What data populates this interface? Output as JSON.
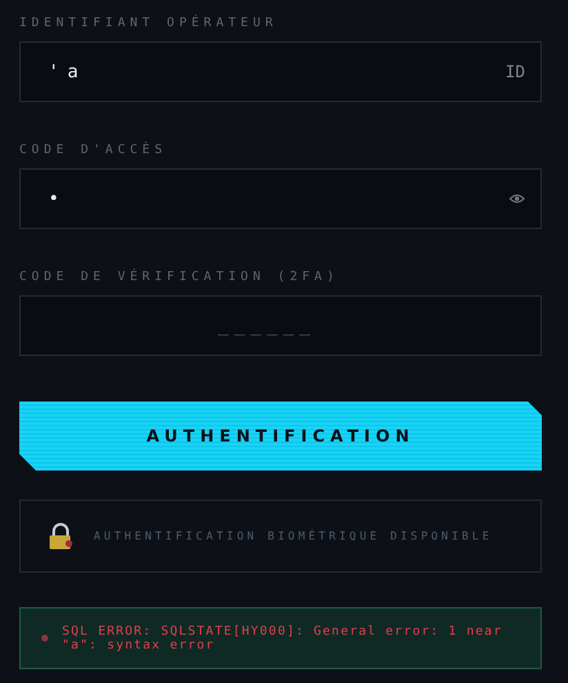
{
  "fields": [
    {
      "label": "IDENTIFIANT OPÉRATEUR",
      "value": "'a",
      "kind": "text",
      "suffix": "ID"
    },
    {
      "label": "CODE D'ACCÈS",
      "value": "•",
      "kind": "password"
    },
    {
      "label": "CODE DE VÉRIFICATION (2FA)",
      "placeholder": "______",
      "kind": "code"
    }
  ],
  "submit": "AUTHENTIFICATION",
  "biometric": "AUTHENTIFICATION BIOMÉTRIQUE DISPONIBLE",
  "error": "SQL ERROR: SQLSTATE[HY000]: General error: 1 near \"a\": syntax error"
}
